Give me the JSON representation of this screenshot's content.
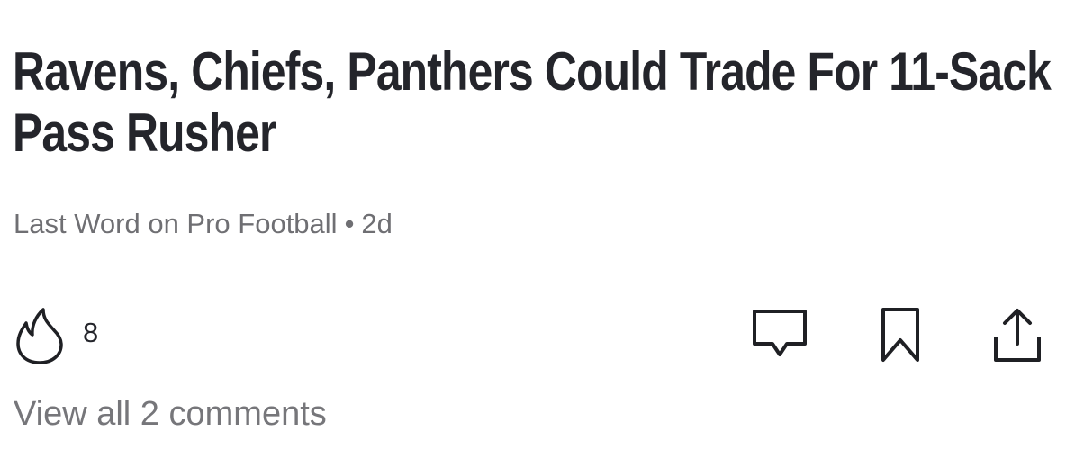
{
  "article": {
    "headline": "Ravens, Chiefs, Panthers Could Trade For 11-Sack Pass Rusher",
    "source": "Last Word on Pro Football",
    "separator": "•",
    "age": "2d"
  },
  "reactions": {
    "fire_icon": "fire-icon",
    "fire_count": "8"
  },
  "actions": {
    "comment_icon": "comment-icon",
    "bookmark_icon": "bookmark-icon",
    "share_icon": "share-icon"
  },
  "comments": {
    "view_all_label": "View all 2 comments"
  },
  "colors": {
    "text_primary": "#24252b",
    "text_secondary": "#6f6f73",
    "background": "#ffffff"
  }
}
